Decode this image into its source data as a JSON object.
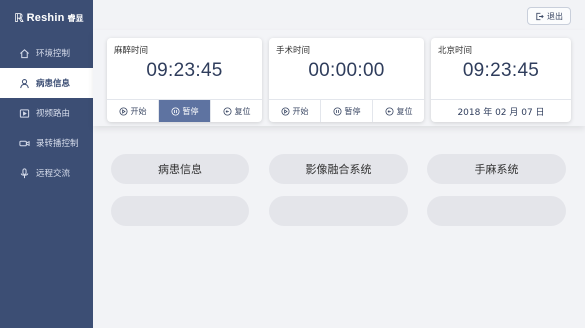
{
  "brand": {
    "mark": "ℝ",
    "name": "Reshin",
    "cn": "睿显"
  },
  "sidebar": {
    "items": [
      {
        "label": "环境控制",
        "icon": "home-icon",
        "active": false
      },
      {
        "label": "病患信息",
        "icon": "user-icon",
        "active": true
      },
      {
        "label": "视频路由",
        "icon": "video-icon",
        "active": false
      },
      {
        "label": "录转播控制",
        "icon": "camera-icon",
        "active": false
      },
      {
        "label": "远程交流",
        "icon": "microphone-icon",
        "active": false
      }
    ]
  },
  "header": {
    "exit_label": "退出",
    "exit_icon": "exit-icon"
  },
  "timers": [
    {
      "title": "麻醉时间",
      "time": "09:23:45",
      "start": "开始",
      "pause": "暂停",
      "reset": "复位"
    },
    {
      "title": "手术时间",
      "time": "00:00:00",
      "start": "开始",
      "pause": "暂停",
      "reset": "复位"
    },
    {
      "title": "北京时间",
      "time": "09:23:45",
      "date": "2018 年 02 月 07 日"
    }
  ],
  "buttons": {
    "row1": [
      "病患信息",
      "影像融合系统",
      "手麻系统"
    ],
    "row2": [
      "",
      "",
      ""
    ]
  },
  "colors": {
    "sidebar": "#3c4e74",
    "accent": "#5e73a1",
    "background": "#f2f3f6"
  }
}
